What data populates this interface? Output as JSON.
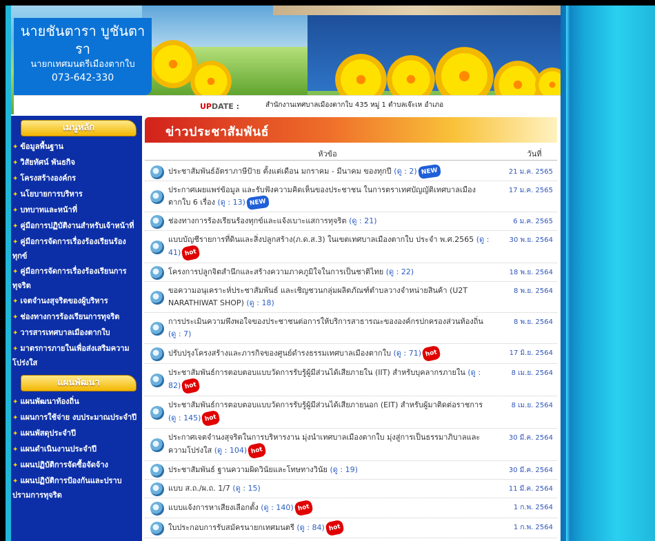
{
  "header": {
    "name_line1": "นายชันตารา บูชันตารา",
    "name_line2": "นายกเทศมนตรีเมืองตากใบ",
    "phone": "073-642-330",
    "update_label_up": "UP",
    "update_label_rest": "DATE :",
    "marquee": "สำนักงานเทศบาลเมืองตากใบ 435 หมู่ 1 ตำบลเจ๊ะเห อำเภอ"
  },
  "sidebar": {
    "main_menu_title": "เมนูหลัก",
    "main_items": [
      "ข้อมูลพื้นฐาน",
      "วิสัยทัศน์ พันธกิจ",
      "โครงสร้างองค์กร",
      "นโยบายการบริหาร",
      "บทบาทและหน้าที่",
      "คู่มือการปฏิบัติงานสำหรับเจ้าหน้าที่",
      "คู่มือการจัดการเรื่องร้องเรียนร้องทุกข์",
      "คู่มือการจัดการเรื่องร้องเรียนการทุจริต",
      "เจตจำนงสุจริตของผู้บริหาร",
      "ช่องทางการร้องเรียนการทุจริต",
      "วารสารเทศบาลเมืองตากใบ",
      "มาตรการภายในเพื่อส่งเสริมความโปร่งใส"
    ],
    "plan_menu_title": "แผนพัฒนา",
    "plan_items": [
      "แผนพัฒนาท้องถิ่น",
      "แผนการใช้จ่าย งบประมาณประจำปี",
      "แผนพัสดุประจำปี",
      "แผนดำเนินงานประจำปี",
      "แผนปฏิบัติการจัดซื้อจัดจ้าง",
      "แผนปฏิบัติการป้องกันและปราบปรามการทุจริต"
    ]
  },
  "news": {
    "heading": "ข่าวประชาสัมพันธ์",
    "col_title": "หัวข้อ",
    "col_date": "วันที่",
    "new_badge": "NEW",
    "hot_badge": "hot",
    "items": [
      {
        "title": "ประชาสัมพันธ์อัตราภาษีป้าย ตั้งแต่เดือน มกราคม - มีนาคม ของทุกปี",
        "count": "(ดู : 2)",
        "date": "21 ม.ค. 2565",
        "badge": "new"
      },
      {
        "title": "ประกาศเผยแพร่ข้อมูล และรับฟังความคิดเห็นของประชาชน ในการตราเทศบัญญัติเทศบาลเมืองตากใบ 6 เรื่อง",
        "count": "(ดู : 13)",
        "date": "17 ม.ค. 2565",
        "badge": "new"
      },
      {
        "title": "ช่องทางการร้องเรียนร้องทุกข์และแจ้งเบาะแสการทุจริต",
        "count": "(ดู : 21)",
        "date": "6 ม.ค. 2565",
        "badge": ""
      },
      {
        "title": "แบบบัญชีรายการที่ดินและสิ่งปลูกสร้าง(ภ.ด.ส.3) ในเขตเทศบาลเมืองตากใบ ประจำ พ.ศ.2565",
        "count": "(ดู : 41)",
        "date": "30 พ.ย. 2564",
        "badge": "hot"
      },
      {
        "title": "โครงการปลูกจิตสำนึกและสร้างความภาคภูมิใจในการเป็นชาติไทย",
        "count": "(ดู : 22)",
        "date": "18 พ.ย. 2564",
        "badge": ""
      },
      {
        "title": "ขอความอนุเคราะห์ประชาสัมพันธ์ และเชิญชวนกลุ่มผลิตภัณฑ์ตำบลวางจำหน่ายสินค้า (U2T NARATHIWAT SHOP)",
        "count": "(ดู : 18)",
        "date": "8 พ.ย. 2564",
        "badge": ""
      },
      {
        "title": "การประเมินความพึงพอใจของประชาชนต่อการให้บริการสาธารณะขององค์กรปกครองส่วนท้องถิ่น",
        "count": "(ดู : 7)",
        "date": "8 พ.ย. 2564",
        "badge": ""
      },
      {
        "title": "ปรับปรุงโครงสร้างและภารกิจของศูนย์ดำรงธรรมเทศบาลเมืองตากใบ",
        "count": "(ดู : 71)",
        "date": "17 มิ.ย. 2564",
        "badge": "hot"
      },
      {
        "title": "ประชาสัมพันธ์การตอบตอบแบบวัดการรับรู้ผู้มีส่วนได้เสียภายใน (IIT) สำหรับบุคลากรภายใน",
        "count": "(ดู : 82)",
        "date": "8 เม.ย. 2564",
        "badge": "hot"
      },
      {
        "title": "ประชาสัมพันธ์การตอบตอบแบบวัดการรับรู้ผู้มีส่วนได้เสียภายนอก (EIT) สำหรับผู้มาติดต่อราชการ",
        "count": "(ดู : 145)",
        "date": "8 เม.ย. 2564",
        "badge": "hot"
      },
      {
        "title": "ประกาศเจตจำนงสุจริตในการบริหารงาน มุ่งนำเทศบาลเมืองตากใบ มุ่งสู่การเป็นธรรมาภิบาลและความโปร่งใส",
        "count": "(ดู : 104)",
        "date": "30 มี.ค. 2564",
        "badge": "hot"
      },
      {
        "title": "ประชาสัมพันธ์ ฐานความผิดวินัยและโทษทางวินัย",
        "count": "(ดู : 19)",
        "date": "30 มี.ค. 2564",
        "badge": ""
      },
      {
        "title": "แบบ ส.ถ./ผ.ถ. 1/7",
        "count": "(ดู : 15)",
        "date": "11 มี.ค. 2564",
        "badge": ""
      },
      {
        "title": "แบบแจ้งการหาเสียงเลือกตั้ง",
        "count": "(ดู : 140)",
        "date": "1 ก.พ. 2564",
        "badge": "hot"
      },
      {
        "title": "ใบประกอบการรับสมัครนายกเทศมนตรี",
        "count": "(ดู : 84)",
        "date": "1 ก.พ. 2564",
        "badge": "hot"
      }
    ]
  },
  "colors": {
    "sidebar_bg": "#0c2fa8",
    "accent_red": "#d2221c",
    "menu_gold": "#f2b600",
    "outer_bg": "#1fb8dc"
  }
}
